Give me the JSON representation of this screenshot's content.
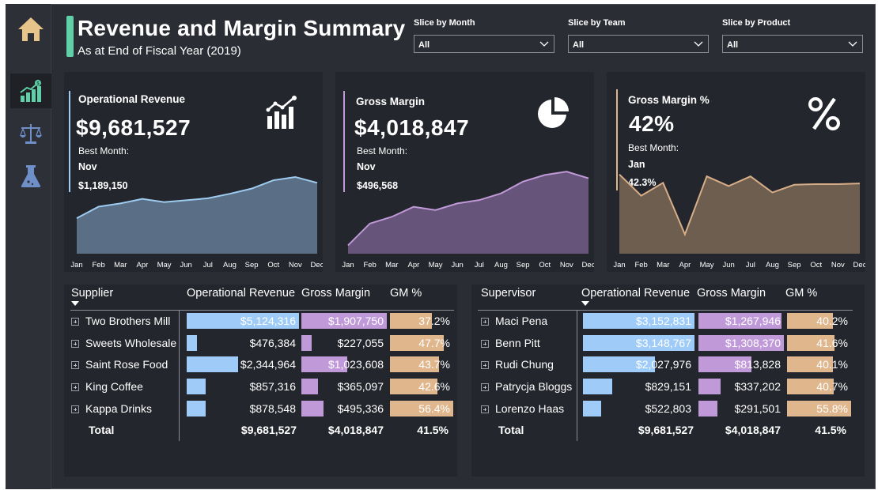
{
  "header": {
    "title": "Revenue and Margin Summary",
    "subtitle": "As at End of Fiscal Year (2019)"
  },
  "nav": [
    {
      "name": "home",
      "icon": "home-icon"
    },
    {
      "name": "revenue",
      "icon": "growth-chart-icon",
      "active": true
    },
    {
      "name": "balance",
      "icon": "scales-icon"
    },
    {
      "name": "lab",
      "icon": "flask-icon"
    }
  ],
  "slicers": [
    {
      "label": "Slice by Month",
      "value": "All"
    },
    {
      "label": "Slice by Team",
      "value": "All"
    },
    {
      "label": "Slice by Product",
      "value": "All"
    }
  ],
  "kpis": [
    {
      "title": "Operational Revenue",
      "value": "$9,681,527",
      "best_label": "Best Month:",
      "best_month": "Nov",
      "best_amount": "$1,189,150",
      "icon": "bar-growth-icon",
      "accent": "#9ecbf0",
      "fill": "#5a6e86",
      "line": "#9ecbf0"
    },
    {
      "title": "Gross Margin",
      "value": "$4,018,847",
      "best_label": "Best Month:",
      "best_month": "Nov",
      "best_amount": "$496,568",
      "icon": "pie-chart-icon",
      "accent": "#c09ad8",
      "fill": "#66547a",
      "line": "#c09ad8"
    },
    {
      "title": "Gross Margin %",
      "value": "42%",
      "best_label": "Best Month:",
      "best_month": "Jan",
      "best_amount": "42.3%",
      "icon": "percent-icon",
      "accent": "#e0b68d",
      "fill": "#6e5e50",
      "line": "#d8ae88"
    }
  ],
  "chart_data": [
    {
      "type": "area",
      "categories": [
        "Jan",
        "Feb",
        "Mar",
        "Apr",
        "May",
        "Jun",
        "Jul",
        "Aug",
        "Sep",
        "Oct",
        "Nov",
        "Dec"
      ],
      "series": [
        {
          "values": [
            0.55,
            0.73,
            0.78,
            0.85,
            0.8,
            0.83,
            0.86,
            0.93,
            1.01,
            1.14,
            1.19,
            1.1
          ]
        }
      ],
      "ylim": [
        0,
        1.3
      ]
    },
    {
      "type": "area",
      "categories": [
        "Jan",
        "Feb",
        "Mar",
        "Apr",
        "May",
        "Jun",
        "Jul",
        "Aug",
        "Sep",
        "Oct",
        "Nov",
        "Dec"
      ],
      "series": [
        {
          "values": [
            0.05,
            0.18,
            0.22,
            0.28,
            0.26,
            0.3,
            0.32,
            0.36,
            0.43,
            0.47,
            0.49,
            0.45
          ]
        }
      ],
      "ylim": [
        0,
        0.5
      ]
    },
    {
      "type": "area",
      "categories": [
        "Jan",
        "Feb",
        "Mar",
        "Apr",
        "May",
        "Jun",
        "Jul",
        "Aug",
        "Sep",
        "Oct",
        "Nov",
        "Dec"
      ],
      "series": [
        {
          "values": [
            0.423,
            0.39,
            0.41,
            0.33,
            0.42,
            0.405,
            0.42,
            0.395,
            0.407,
            0.408,
            0.408,
            0.409
          ]
        }
      ],
      "ylim": [
        0.3,
        0.43
      ]
    }
  ],
  "tables": [
    {
      "group_header": "Supplier",
      "col_headers": [
        "Operational Revenue",
        "Gross Margin",
        "GM %"
      ],
      "rows": [
        {
          "name": "Two Brothers Mill",
          "rev": "$5,124,316",
          "rev_frac": 1.0,
          "gm": "$1,907,750",
          "gm_frac": 1.0,
          "pct": "37.2%",
          "pct_frac": 0.66
        },
        {
          "name": "Sweets Wholesale",
          "rev": "$476,384",
          "rev_frac": 0.093,
          "gm": "$227,055",
          "gm_frac": 0.119,
          "pct": "47.7%",
          "pct_frac": 0.846
        },
        {
          "name": "Saint Rose Food",
          "rev": "$2,344,964",
          "rev_frac": 0.458,
          "gm": "$1,023,608",
          "gm_frac": 0.537,
          "pct": "43.7%",
          "pct_frac": 0.775
        },
        {
          "name": "King Coffee",
          "rev": "$857,316",
          "rev_frac": 0.167,
          "gm": "$365,097",
          "gm_frac": 0.191,
          "pct": "42.6%",
          "pct_frac": 0.755
        },
        {
          "name": "Kappa Drinks",
          "rev": "$878,548",
          "rev_frac": 0.171,
          "gm": "$495,336",
          "gm_frac": 0.26,
          "pct": "56.4%",
          "pct_frac": 1.0
        }
      ],
      "total": {
        "label": "Total",
        "rev": "$9,681,527",
        "gm": "$4,018,847",
        "pct": "41.5%"
      }
    },
    {
      "group_header": "Supervisor",
      "col_headers": [
        "Operational Revenue",
        "Gross Margin",
        "GM %"
      ],
      "rows": [
        {
          "name": "Maci Pena",
          "rev": "$3,152,831",
          "rev_frac": 1.0,
          "gm": "$1,267,946",
          "gm_frac": 0.969,
          "pct": "40.2%",
          "pct_frac": 0.72
        },
        {
          "name": "Benn Pitt",
          "rev": "$3,148,767",
          "rev_frac": 0.999,
          "gm": "$1,308,370",
          "gm_frac": 1.0,
          "pct": "41.6%",
          "pct_frac": 0.745
        },
        {
          "name": "Rudi Chung",
          "rev": "$2,027,976",
          "rev_frac": 0.643,
          "gm": "$813,828",
          "gm_frac": 0.622,
          "pct": "40.1%",
          "pct_frac": 0.719
        },
        {
          "name": "Patrycja Bloggs",
          "rev": "$829,151",
          "rev_frac": 0.263,
          "gm": "$337,202",
          "gm_frac": 0.258,
          "pct": "40.7%",
          "pct_frac": 0.729
        },
        {
          "name": "Lorenzo Haas",
          "rev": "$522,803",
          "rev_frac": 0.166,
          "gm": "$291,501",
          "gm_frac": 0.223,
          "pct": "55.8%",
          "pct_frac": 1.0
        }
      ],
      "total": {
        "label": "Total",
        "rev": "$9,681,527",
        "gm": "$4,018,847",
        "pct": "41.5%"
      }
    }
  ],
  "colors": {
    "rev_bar": "#9ecbf7",
    "gm_bar": "#c09ad8",
    "pct_bar": "#e0b68d",
    "accent": "#5fd0a7"
  }
}
